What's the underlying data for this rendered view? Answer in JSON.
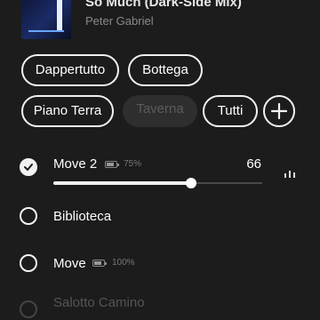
{
  "now_playing": {
    "title": "So Much (Dark-Side Mix)",
    "artist": "Peter Gabriel"
  },
  "groups": {
    "chips": [
      "Dappertutto",
      "Bottega",
      "Piano Terra",
      "Taverna",
      "Tutti"
    ],
    "disabled_chip": "Taverna",
    "add_icon": "plus-icon"
  },
  "rooms": [
    {
      "name": "Move 2",
      "selected": true,
      "battery_icon": "battery-icon",
      "battery": "75%",
      "volume": "66",
      "volume_level": 0.66,
      "eq_icon": "equalizer-icon"
    },
    {
      "name": "Biblioteca",
      "selected": false
    },
    {
      "name": "Move",
      "selected": false,
      "badge_icon": "battery-icon",
      "battery": "100%"
    },
    {
      "name": "Salotto Camino",
      "selected": false,
      "disabled": true
    }
  ],
  "colors": {
    "background": "#1c1c1c",
    "foreground": "#f2f2f2",
    "muted": "#8a8a8a",
    "disabled_chip_bg": "#2e2e2e"
  }
}
